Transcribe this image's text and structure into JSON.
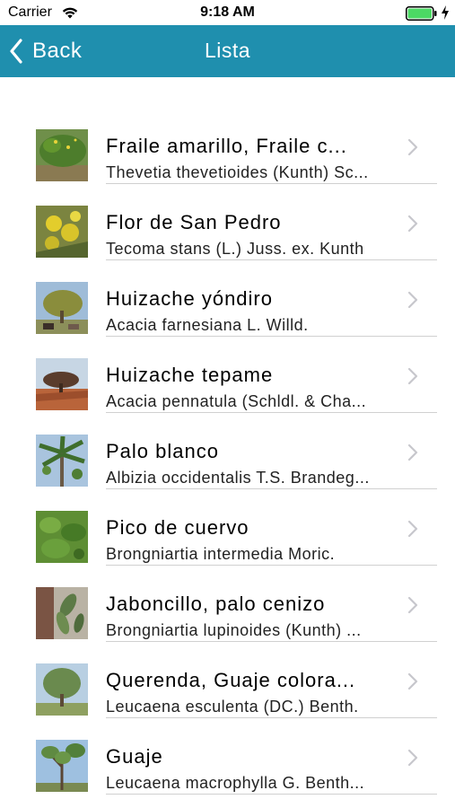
{
  "status_bar": {
    "carrier": "Carrier",
    "time": "9:18 AM"
  },
  "nav": {
    "back_label": "Back",
    "title": "Lista"
  },
  "items": [
    {
      "title": "Fraile amarillo, Fraile c...",
      "subtitle": "Thevetia thevetioides (Kunth) Sc..."
    },
    {
      "title": "Flor de San Pedro",
      "subtitle": "Tecoma stans (L.) Juss. ex. Kunth"
    },
    {
      "title": "Huizache yóndiro",
      "subtitle": "Acacia farnesiana L. Willd."
    },
    {
      "title": "Huizache tepame",
      "subtitle": "Acacia pennatula (Schldl. & Cha..."
    },
    {
      "title": "Palo blanco",
      "subtitle": "Albizia occidentalis T.S. Brandeg..."
    },
    {
      "title": "Pico de cuervo",
      "subtitle": "Brongniartia intermedia Moric."
    },
    {
      "title": "Jaboncillo, palo cenizo",
      "subtitle": "Brongniartia lupinoides (Kunth) ..."
    },
    {
      "title": "Querenda, Guaje colora...",
      "subtitle": "Leucaena esculenta (DC.) Benth."
    },
    {
      "title": "Guaje",
      "subtitle": "Leucaena macrophylla G. Benth..."
    }
  ],
  "colors": {
    "nav_background": "#1f8fae",
    "battery": "#4cd964"
  },
  "icons": {
    "back": "chevron-left-icon",
    "row": "chevron-right-icon",
    "wifi": "wifi-icon",
    "battery": "battery-icon",
    "charging": "bolt-icon"
  }
}
